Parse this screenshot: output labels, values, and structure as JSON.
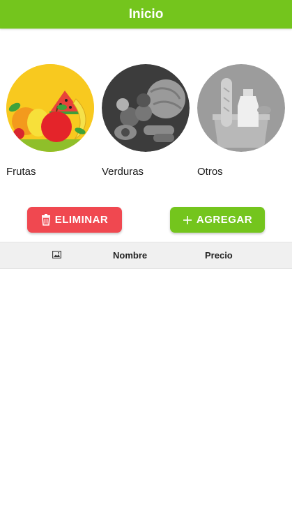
{
  "app_bar": {
    "title": "Inicio"
  },
  "categories": [
    {
      "label": "Frutas",
      "icon": "fruits-image"
    },
    {
      "label": "Verduras",
      "icon": "vegetables-image"
    },
    {
      "label": "Otros",
      "icon": "groceries-image"
    }
  ],
  "actions": {
    "delete_label": "ELIMINAR",
    "add_label": "AGREGAR",
    "delete_icon": "trash-icon",
    "add_icon": "plus-icon"
  },
  "table": {
    "image_column_icon": "image-icon",
    "name_header": "Nombre",
    "price_header": "Precio"
  },
  "colors": {
    "primary": "#74c51d",
    "danger": "#f04850",
    "header_bg": "#f0f0f0"
  }
}
